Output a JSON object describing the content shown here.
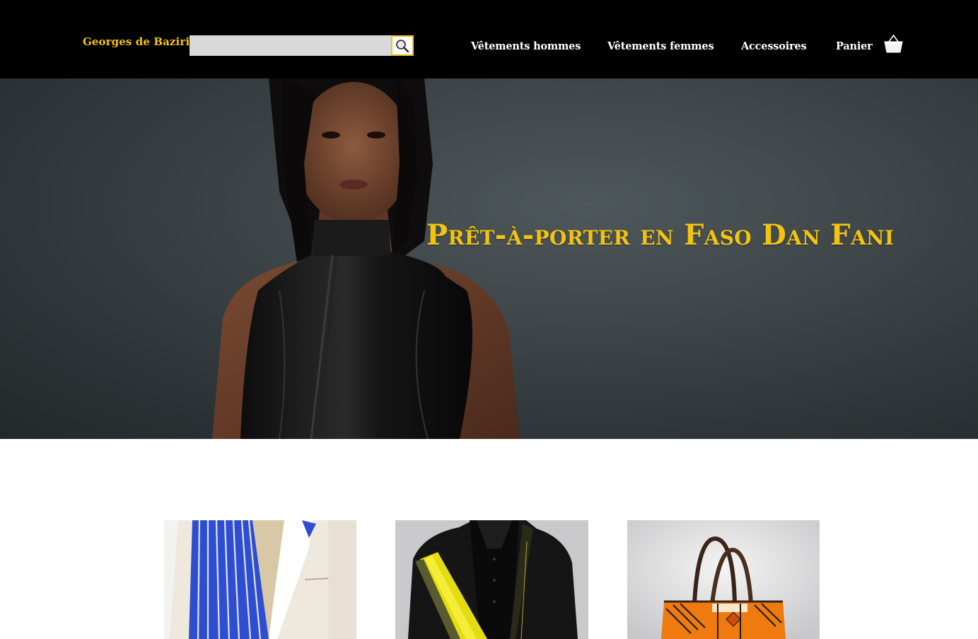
{
  "header": {
    "logo": "Georges de Baziri",
    "search": {
      "placeholder": "",
      "value": ""
    },
    "nav": [
      {
        "label": "Vêtements hommes"
      },
      {
        "label": "Vêtements femmes"
      },
      {
        "label": "Accessoires"
      },
      {
        "label": "Panier"
      }
    ],
    "icons": {
      "search": "search-icon",
      "cart": "basket-icon"
    }
  },
  "hero": {
    "title": "Prêt-à-porter en Faso Dan Fani"
  },
  "products": [
    {
      "kind": "men-jacket-blue-white"
    },
    {
      "kind": "men-jacket-black-yellow"
    },
    {
      "kind": "tote-bag-orange"
    }
  ],
  "colors": {
    "accent": "#f2c40f",
    "header_bg": "#000000",
    "hero_bg": "#3f474a",
    "search_bg": "#d9d9d9"
  }
}
